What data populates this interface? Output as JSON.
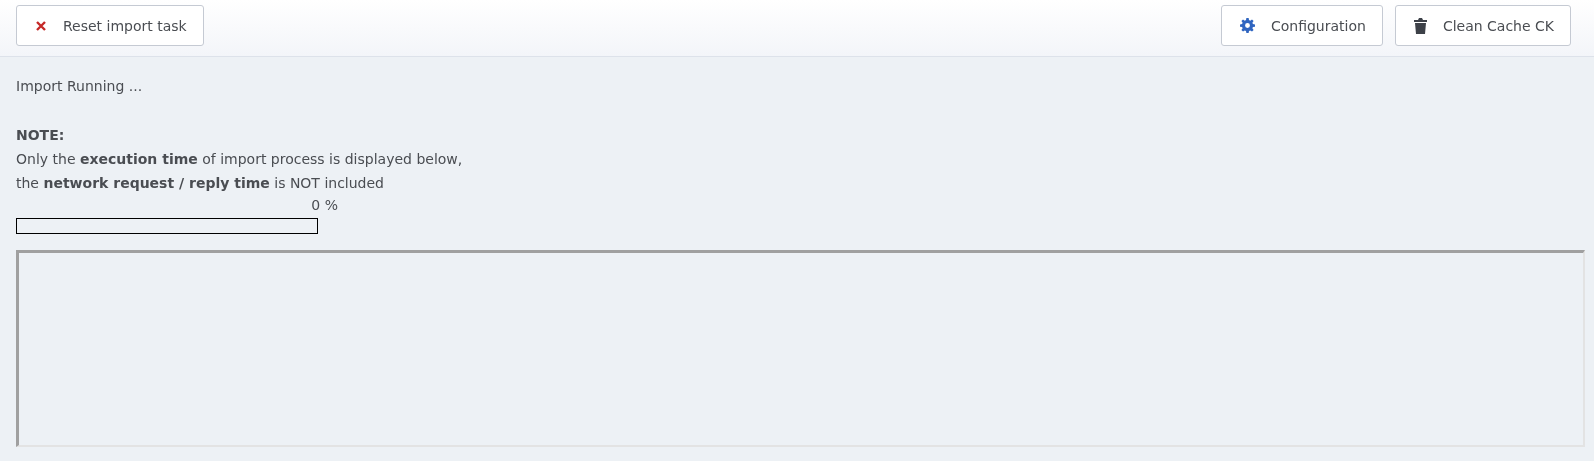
{
  "toolbar": {
    "buttons": [
      {
        "label": "Reset import task"
      },
      {
        "label": "Configuration"
      },
      {
        "label": "Clean Cache CK"
      }
    ]
  },
  "status": "Import Running ...",
  "note": {
    "title": "NOTE:",
    "lines": [
      "Only the **execution time** of import process is displayed below,",
      "the **network request / reply time** is NOT included"
    ]
  },
  "progress": {
    "reading": "0 %",
    "level": 0
  }
}
